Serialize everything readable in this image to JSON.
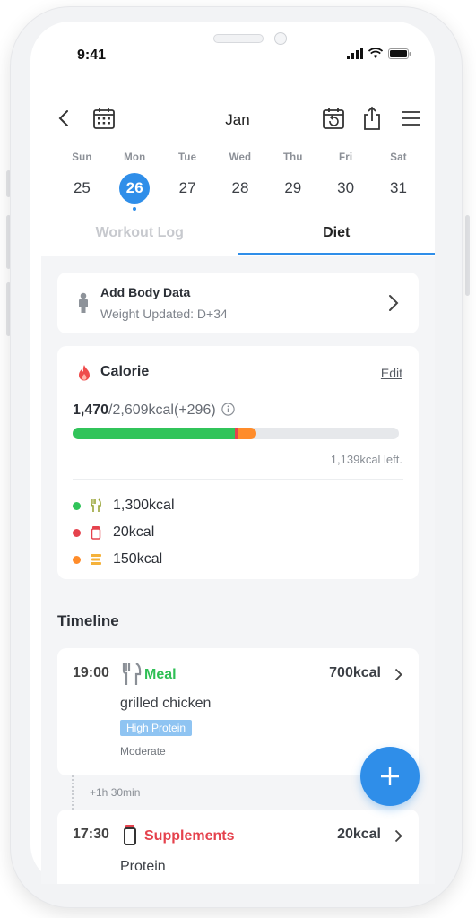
{
  "status_bar": {
    "time": "9:41"
  },
  "header": {
    "month": "Jan"
  },
  "week": [
    {
      "name": "Sun",
      "date": "25"
    },
    {
      "name": "Mon",
      "date": "26"
    },
    {
      "name": "Tue",
      "date": "27"
    },
    {
      "name": "Wed",
      "date": "28"
    },
    {
      "name": "Thu",
      "date": "29"
    },
    {
      "name": "Fri",
      "date": "30"
    },
    {
      "name": "Sat",
      "date": "31"
    }
  ],
  "selected_day_index": 1,
  "tabs": {
    "workout": "Workout Log",
    "diet": "Diet",
    "active": "Diet"
  },
  "body_data": {
    "title": "Add Body Data",
    "subtitle": "Weight Updated: D+34"
  },
  "calorie": {
    "title": "Calorie",
    "edit_label": "Edit",
    "consumed": "1,470",
    "target": "/2,609kcal(+296)",
    "left": "1,139kcal left.",
    "progress_segments": [
      {
        "name": "meal",
        "fraction": 0.498,
        "color": "#31c45a"
      },
      {
        "name": "supplement",
        "fraction": 0.008,
        "color": "#e5424d"
      },
      {
        "name": "snack",
        "fraction": 0.058,
        "color": "#ff8c2a"
      }
    ],
    "legend": [
      {
        "icon": "fork-knife-icon",
        "value": "1,300kcal",
        "color": "#31c45a"
      },
      {
        "icon": "supplement-bottle-icon",
        "value": "20kcal",
        "color": "#e5424d"
      },
      {
        "icon": "snack-icon",
        "value": "150kcal",
        "color": "#ff8c2a"
      }
    ]
  },
  "timeline": {
    "title": "Timeline",
    "entries": [
      {
        "time": "19:00",
        "type": "Meal",
        "type_color": "#2fbf55",
        "kcal": "700kcal",
        "food": "grilled chicken",
        "tag": "High Protein",
        "note": "Moderate"
      },
      {
        "time": "17:30",
        "type": "Supplements",
        "type_color": "#e5424d",
        "kcal": "20kcal",
        "food": "Protein"
      }
    ],
    "gap": "+1h 30min"
  },
  "colors": {
    "accent": "#2f8ee9"
  }
}
